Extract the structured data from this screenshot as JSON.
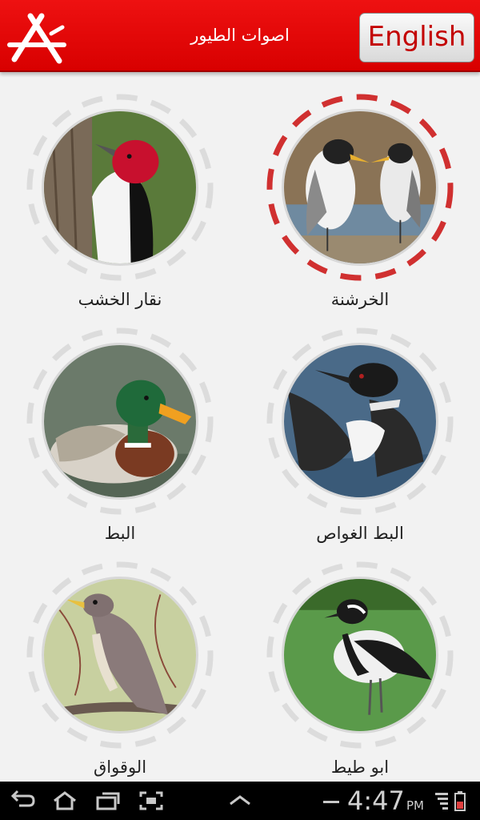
{
  "header": {
    "title": "اصوات الطيور",
    "language_button": "English",
    "colors": {
      "bar": "#e60000",
      "button_text": "#c30000"
    }
  },
  "birds": [
    {
      "label": "الخرشنة",
      "photo_icon": "tern-photo-icon",
      "selected": true
    },
    {
      "label": "نقار الخشب",
      "photo_icon": "woodpecker-photo-icon",
      "selected": false
    },
    {
      "label": "البط الغواص",
      "photo_icon": "loon-photo-icon",
      "selected": false
    },
    {
      "label": "البط",
      "photo_icon": "mallard-photo-icon",
      "selected": false
    },
    {
      "label": "ابو طيط",
      "photo_icon": "lapwing-photo-icon",
      "selected": false
    },
    {
      "label": "الوقواق",
      "photo_icon": "cuckoo-photo-icon",
      "selected": false
    }
  ],
  "ring_colors": {
    "selected": "#d03030",
    "idle": "#dcdcdc"
  },
  "system_bar": {
    "time": "4:47",
    "ampm": "PM",
    "icons": [
      "back-icon",
      "home-icon",
      "recent-apps-icon",
      "screenshot-icon",
      "up-chevron-icon",
      "signal-icon",
      "battery-icon"
    ]
  }
}
